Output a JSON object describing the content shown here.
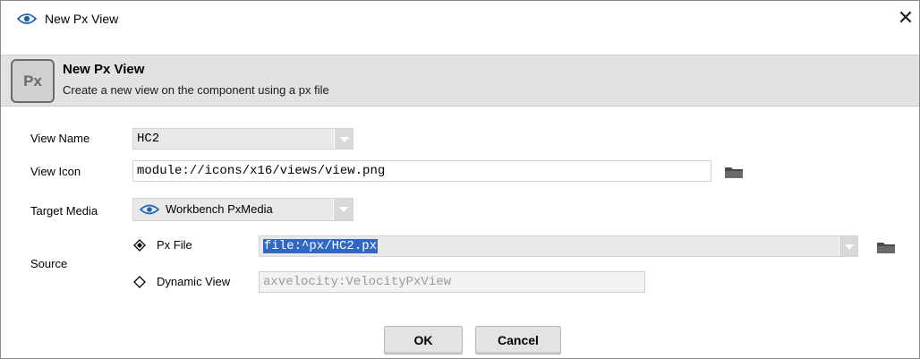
{
  "window": {
    "title": "New Px View",
    "close_glyph": "✕"
  },
  "header": {
    "icon_text": "Px",
    "title": "New Px View",
    "subtitle": "Create a new view on the component using a px file"
  },
  "form": {
    "view_name_label": "View Name",
    "view_name_value": "HC2",
    "view_icon_label": "View Icon",
    "view_icon_value": "module://icons/x16/views/view.png",
    "target_media_label": "Target Media",
    "target_media_value": "Workbench PxMedia",
    "source_label": "Source",
    "px_file_label": "Px File",
    "px_file_value": "file:^px/HC2.px",
    "dynamic_view_label": "Dynamic View",
    "dynamic_view_value": "axvelocity:VelocityPxView",
    "selected_source": "Px File"
  },
  "buttons": {
    "ok": "OK",
    "cancel": "Cancel"
  },
  "icons": {
    "app": "niagara-eye-icon",
    "folder": "folder-icon",
    "media": "niagara-eye-icon"
  },
  "colors": {
    "selection": "#3168c4",
    "brand": "#1e63b4"
  }
}
